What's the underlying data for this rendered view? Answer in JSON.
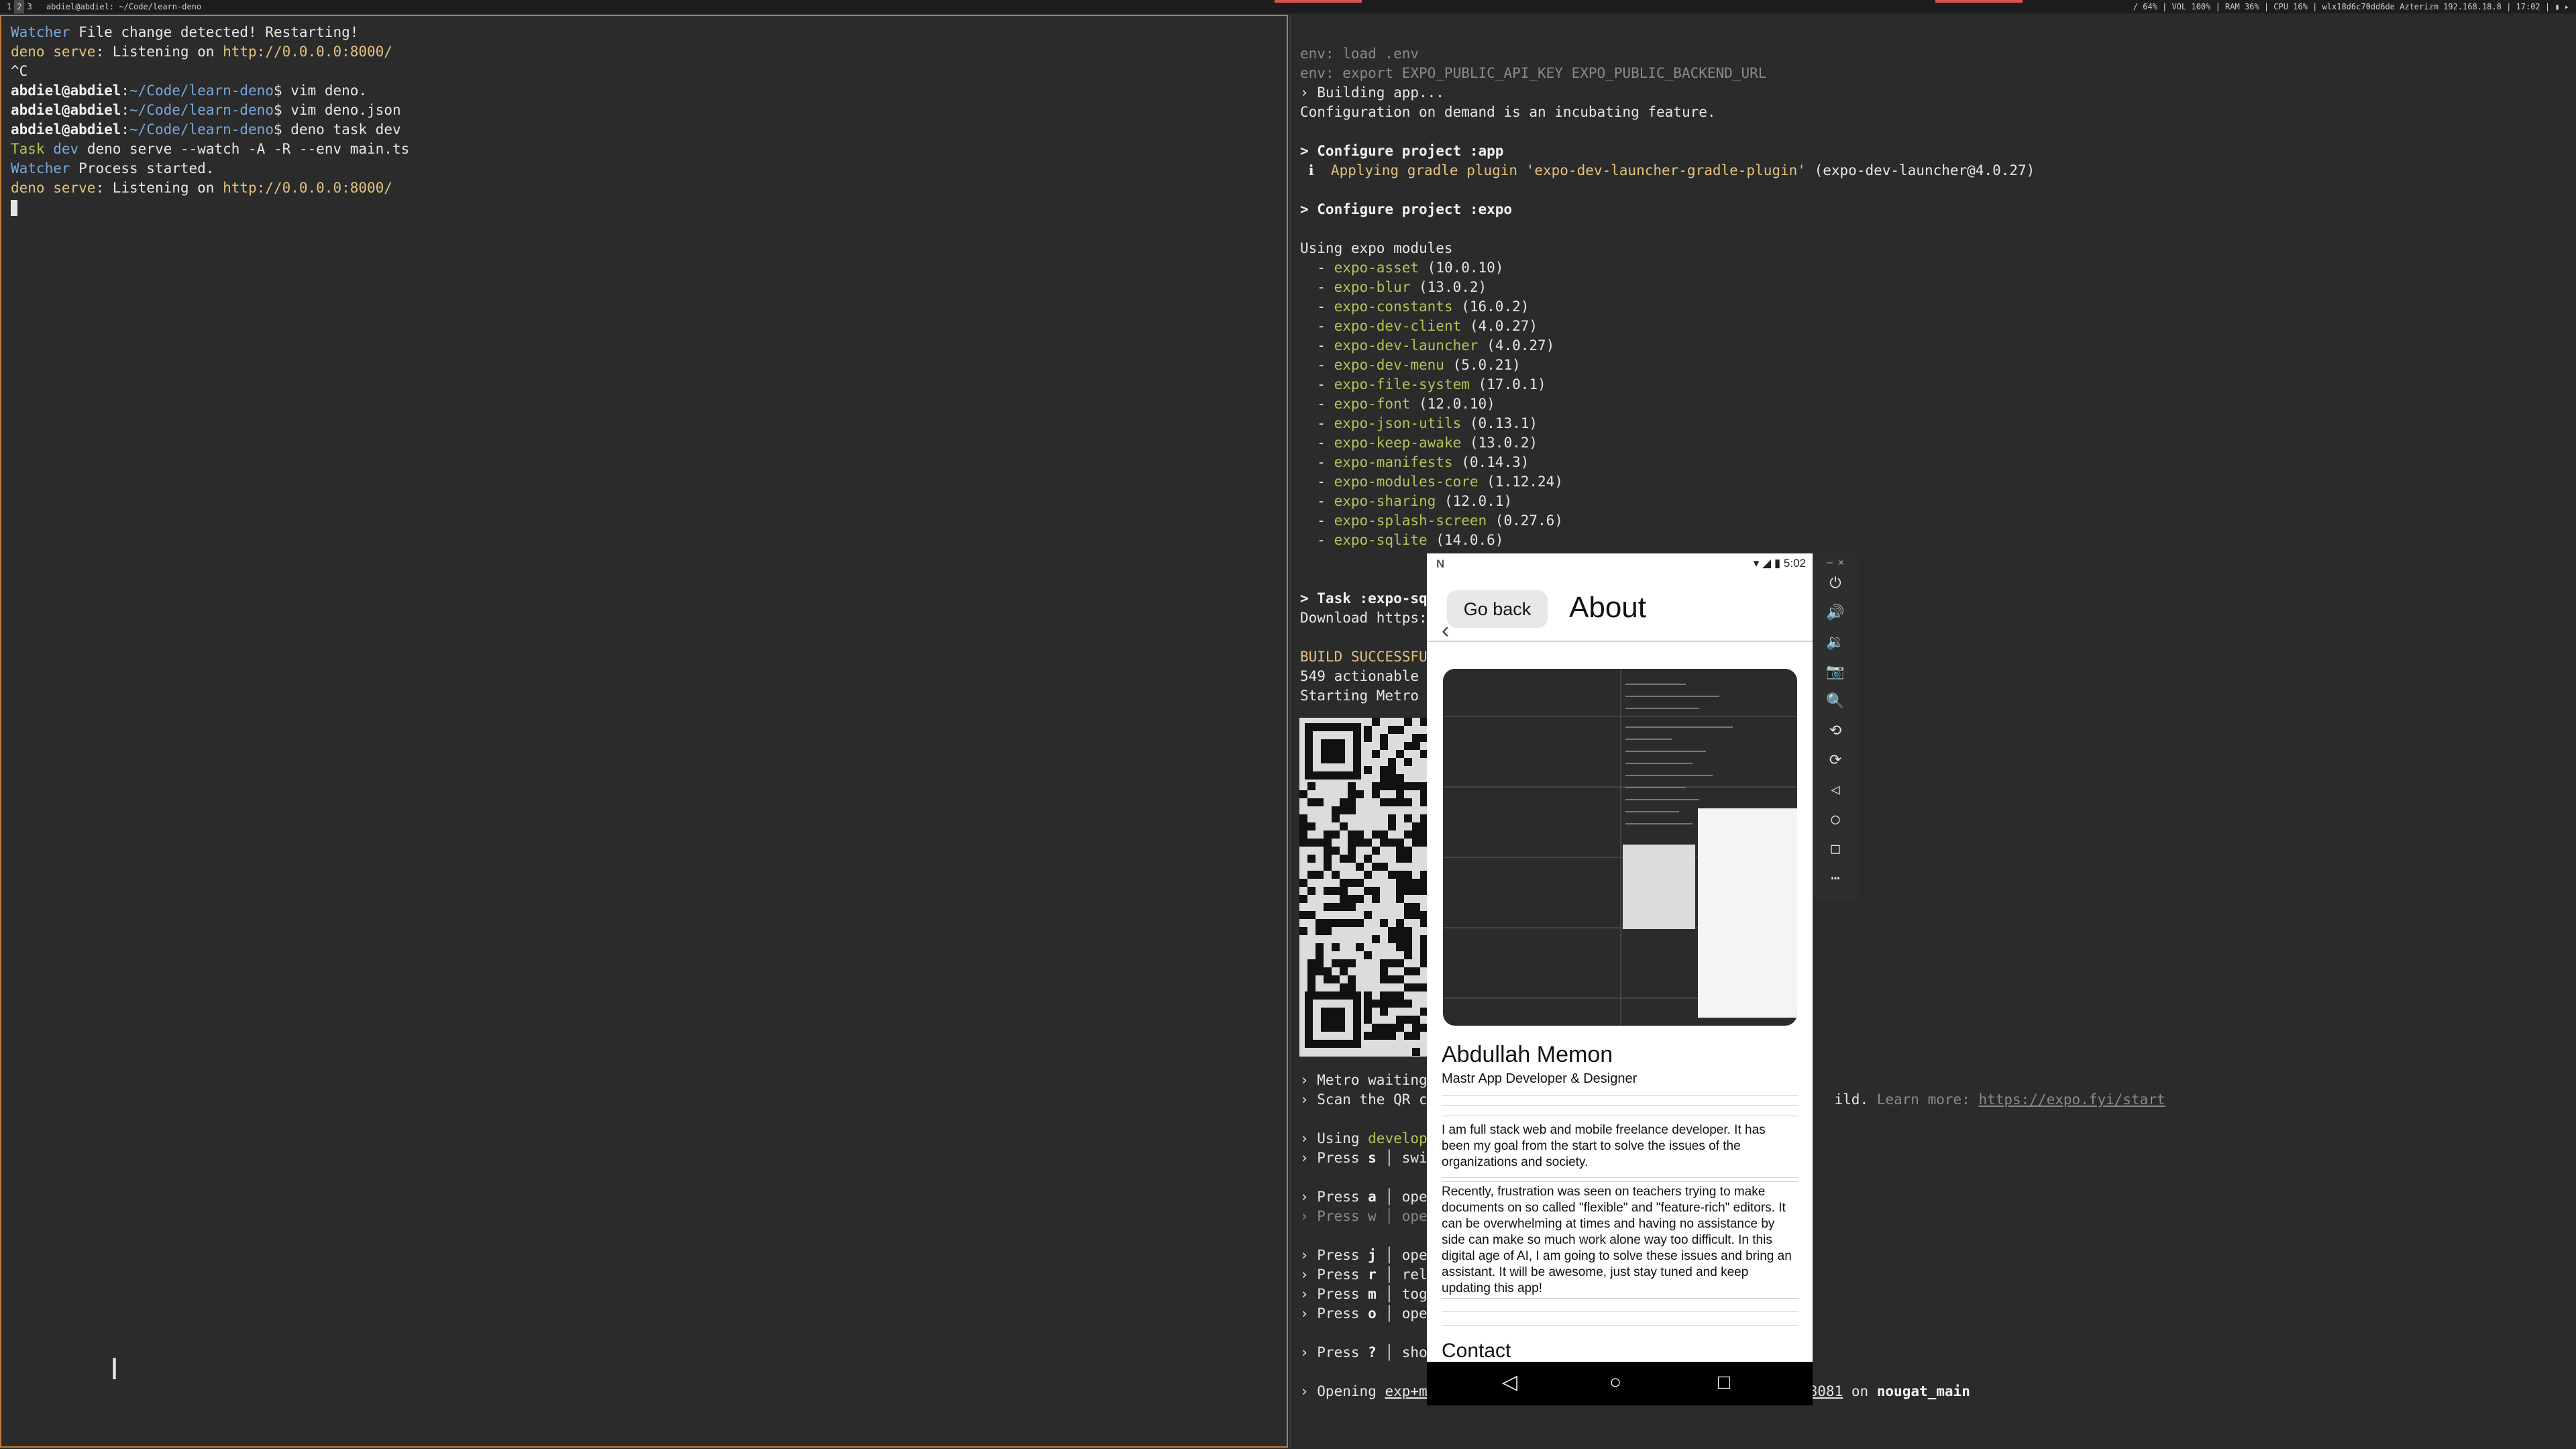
{
  "topbar": {
    "workspaces": [
      "1",
      "2",
      "3"
    ],
    "window_title": "abdiel@abdiel: ~/Code/learn-deno",
    "status": "/ 64%  |  VOL 100%  |  RAM 36%  |  CPU 16%  |  wlx18d6c70dd6de Azterizm 192.168.18.8  |  17:02  |  ▮ ▸"
  },
  "left_terminal": {
    "lines": [
      [
        {
          "t": "Watcher",
          "c": "blue"
        },
        {
          "t": " File change detected! Restarting!"
        }
      ],
      [
        {
          "t": "deno serve",
          "c": "yellow"
        },
        {
          "t": ": Listening on "
        },
        {
          "t": "http://0.0.0.0:8000/",
          "c": "yellow"
        }
      ],
      [
        {
          "t": "^C"
        }
      ],
      [
        {
          "t": "abdiel@abdiel",
          "c": "bold"
        },
        {
          "t": ":"
        },
        {
          "t": "~/Code/learn-deno",
          "c": "blue"
        },
        {
          "t": "$ vim deno."
        }
      ],
      [
        {
          "t": "abdiel@abdiel",
          "c": "bold"
        },
        {
          "t": ":"
        },
        {
          "t": "~/Code/learn-deno",
          "c": "blue"
        },
        {
          "t": "$ vim deno.json"
        }
      ],
      [
        {
          "t": "abdiel@abdiel",
          "c": "bold"
        },
        {
          "t": ":"
        },
        {
          "t": "~/Code/learn-deno",
          "c": "blue"
        },
        {
          "t": "$ deno task dev"
        }
      ],
      [
        {
          "t": "Task",
          "c": "green"
        },
        {
          "t": " "
        },
        {
          "t": "dev",
          "c": "blue"
        },
        {
          "t": " deno serve --watch -A -R --env main.ts"
        }
      ],
      [
        {
          "t": "Watcher",
          "c": "blue"
        },
        {
          "t": " Process started."
        }
      ],
      [
        {
          "t": "deno serve",
          "c": "yellow"
        },
        {
          "t": ": Listening on "
        },
        {
          "t": "http://0.0.0.0:8000/",
          "c": "yellow"
        }
      ]
    ]
  },
  "right_terminal": {
    "lines": [
      [
        {
          "t": "env: load .env",
          "c": "dim"
        }
      ],
      [
        {
          "t": "env: export EXPO_PUBLIC_API_KEY EXPO_PUBLIC_BACKEND_URL",
          "c": "dim"
        }
      ],
      [
        {
          "t": "› Building app..."
        }
      ],
      [
        {
          "t": "Configuration on demand is an incubating feature."
        }
      ],
      [
        {
          "t": ""
        }
      ],
      [
        {
          "t": "> Configure project :app",
          "c": "bold"
        }
      ],
      [
        {
          "t": " ℹ  "
        },
        {
          "t": "Applying gradle plugin 'expo-dev-launcher-gradle-plugin'",
          "c": "yellow"
        },
        {
          "t": " (expo-dev-launcher@4.0.27)"
        }
      ],
      [
        {
          "t": ""
        }
      ],
      [
        {
          "t": "> Configure project :expo",
          "c": "bold"
        }
      ],
      [
        {
          "t": ""
        }
      ],
      [
        {
          "t": "Using expo modules"
        }
      ],
      [
        {
          "t": "  - "
        },
        {
          "t": "expo-asset",
          "c": "green"
        },
        {
          "t": " (10.0.10)"
        }
      ],
      [
        {
          "t": "  - "
        },
        {
          "t": "expo-blur",
          "c": "green"
        },
        {
          "t": " (13.0.2)"
        }
      ],
      [
        {
          "t": "  - "
        },
        {
          "t": "expo-constants",
          "c": "green"
        },
        {
          "t": " (16.0.2)"
        }
      ],
      [
        {
          "t": "  - "
        },
        {
          "t": "expo-dev-client",
          "c": "green"
        },
        {
          "t": " (4.0.27)"
        }
      ],
      [
        {
          "t": "  - "
        },
        {
          "t": "expo-dev-launcher",
          "c": "green"
        },
        {
          "t": " (4.0.27)"
        }
      ],
      [
        {
          "t": "  - "
        },
        {
          "t": "expo-dev-menu",
          "c": "green"
        },
        {
          "t": " (5.0.21)"
        }
      ],
      [
        {
          "t": "  - "
        },
        {
          "t": "expo-file-system",
          "c": "green"
        },
        {
          "t": " (17.0.1)"
        }
      ],
      [
        {
          "t": "  - "
        },
        {
          "t": "expo-font",
          "c": "green"
        },
        {
          "t": " (12.0.10)"
        }
      ],
      [
        {
          "t": "  - "
        },
        {
          "t": "expo-json-utils",
          "c": "green"
        },
        {
          "t": " (0.13.1)"
        }
      ],
      [
        {
          "t": "  - "
        },
        {
          "t": "expo-keep-awake",
          "c": "green"
        },
        {
          "t": " (13.0.2)"
        }
      ],
      [
        {
          "t": "  - "
        },
        {
          "t": "expo-manifests",
          "c": "green"
        },
        {
          "t": " (0.14.3)"
        }
      ],
      [
        {
          "t": "  - "
        },
        {
          "t": "expo-modules-core",
          "c": "green"
        },
        {
          "t": " (1.12.24)"
        }
      ],
      [
        {
          "t": "  - "
        },
        {
          "t": "expo-sharing",
          "c": "green"
        },
        {
          "t": " (12.0.1)"
        }
      ],
      [
        {
          "t": "  - "
        },
        {
          "t": "expo-splash-screen",
          "c": "green"
        },
        {
          "t": " (0.27.6)"
        }
      ],
      [
        {
          "t": "  - "
        },
        {
          "t": "expo-sqlite",
          "c": "green"
        },
        {
          "t": " (14.0.6)"
        }
      ],
      [
        {
          "t": ""
        }
      ],
      [
        {
          "t": ""
        }
      ],
      [
        {
          "t": "> Task :expo-sql",
          "c": "bold"
        }
      ],
      [
        {
          "t": "Download https:/"
        }
      ],
      [
        {
          "t": ""
        }
      ],
      [
        {
          "t": "BUILD SUCCESSFUL",
          "c": "yellow"
        }
      ],
      [
        {
          "t": "549 actionable t"
        }
      ],
      [
        {
          "t": "Starting Metro B"
        }
      ]
    ],
    "lines_bottom": [
      [
        {
          "t": "› Metro waiting          "
        },
        {
          "t": "ttp%3A%2F%2F192.168.18.8%3A8081",
          "c": "u"
        }
      ],
      [
        {
          "t": "› Scan the QR co                                               ild. "
        },
        {
          "t": "Learn more: ",
          "c": "dim"
        },
        {
          "t": "https://expo.fyi/start",
          "c": "u dim"
        }
      ],
      [
        {
          "t": ""
        }
      ],
      [
        {
          "t": "› Using "
        },
        {
          "t": "developm",
          "c": "green"
        }
      ],
      [
        {
          "t": "› Press "
        },
        {
          "t": "s",
          "c": "bold"
        },
        {
          "t": " │ swit"
        }
      ],
      [
        {
          "t": ""
        }
      ],
      [
        {
          "t": "› Press "
        },
        {
          "t": "a",
          "c": "bold"
        },
        {
          "t": " │ open"
        }
      ],
      [
        {
          "t": "› Press w │ open",
          "c": "dim"
        }
      ],
      [
        {
          "t": ""
        }
      ],
      [
        {
          "t": "› Press "
        },
        {
          "t": "j",
          "c": "bold"
        },
        {
          "t": " │ open"
        }
      ],
      [
        {
          "t": "› Press "
        },
        {
          "t": "r",
          "c": "bold"
        },
        {
          "t": " │ relo"
        }
      ],
      [
        {
          "t": "› Press "
        },
        {
          "t": "m",
          "c": "bold"
        },
        {
          "t": " │ togg"
        }
      ],
      [
        {
          "t": "› Press "
        },
        {
          "t": "o",
          "c": "bold"
        },
        {
          "t": " │ open"
        }
      ],
      [
        {
          "t": ""
        }
      ],
      [
        {
          "t": "› Press "
        },
        {
          "t": "?",
          "c": "bold"
        },
        {
          "t": " │ show"
        }
      ],
      [
        {
          "t": ""
        }
      ],
      [
        {
          "t": "› Opening "
        },
        {
          "t": "exp+ma",
          "c": "u"
        },
        {
          "t": "                          "
        },
        {
          "t": "%2F192.168.18.8%3A8081",
          "c": "u"
        },
        {
          "t": " on "
        },
        {
          "t": "nougat_main",
          "c": "bold"
        }
      ]
    ]
  },
  "emulator": {
    "status_left": "N",
    "status_time": "5:02",
    "go_back": "Go back",
    "title": "About",
    "name": "Abdullah Memon",
    "role": "Mastr App Developer & Designer",
    "para1": "I am full stack web and mobile freelance developer. It has been my goal from the start to solve the issues of the organizations and society.",
    "para2": "Recently, frustration was seen on teachers trying to make documents on so called \"flexible\" and \"feature-rich\" editors. It can be overwhelming at times and having no assistance by side can make so much work alone way too difficult. In this digital age of AI, I am going to solve these issues and bring an assistant. It will be awesome, just stay tuned and keep updating this app!",
    "contact": "Contact",
    "nav_back": "◁",
    "nav_home": "○",
    "nav_recent": "□"
  },
  "emulator_toolbar": {
    "window_controls": "–  ×",
    "buttons": [
      {
        "icon": "⏻",
        "name": "power-icon"
      },
      {
        "icon": "🔊",
        "name": "volume-up-icon"
      },
      {
        "icon": "🔉",
        "name": "volume-down-icon"
      },
      {
        "icon": "📷",
        "name": "camera-icon"
      },
      {
        "icon": "🔍",
        "name": "zoom-icon"
      },
      {
        "icon": "⟲",
        "name": "rotate-left-icon"
      },
      {
        "icon": "⟳",
        "name": "rotate-right-icon"
      },
      {
        "icon": "◁",
        "name": "back-icon"
      },
      {
        "icon": "○",
        "name": "home-icon"
      },
      {
        "icon": "□",
        "name": "overview-icon"
      },
      {
        "icon": "⋯",
        "name": "more-icon"
      }
    ]
  }
}
